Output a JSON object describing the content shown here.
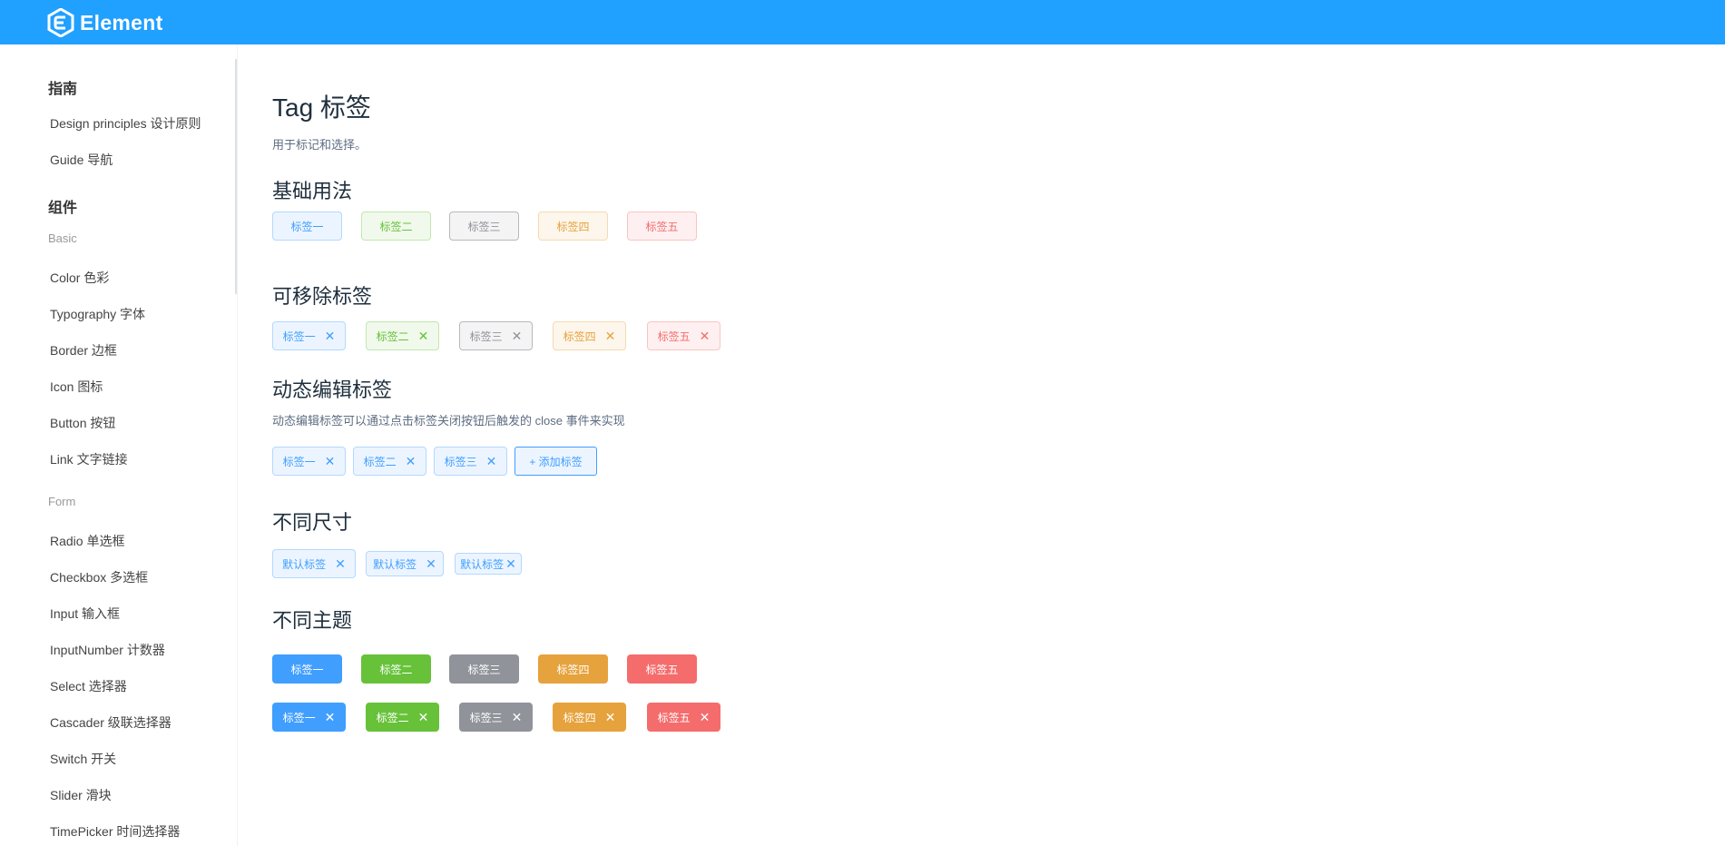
{
  "header": {
    "logo_text": "Element",
    "logo_icon": "element-logo-icon",
    "bg_color": "#20a0ff"
  },
  "sidebar": {
    "group_guide": "指南",
    "guide_items": [
      "Design principles 设计原则",
      "Guide 导航"
    ],
    "group_components": "组件",
    "sub_basic": "Basic",
    "basic_items": [
      "Color 色彩",
      "Typography 字体",
      "Border 边框",
      "Icon 图标",
      "Button 按钮",
      "Link 文字链接"
    ],
    "sub_form": "Form",
    "form_items": [
      "Radio 单选框",
      "Checkbox 多选框",
      "Input 输入框",
      "InputNumber 计数器",
      "Select 选择器",
      "Cascader 级联选择器",
      "Switch 开关",
      "Slider 滑块",
      "TimePicker 时间选择器"
    ]
  },
  "page": {
    "title": "Tag 标签",
    "desc": "用于标记和选择。"
  },
  "sections": {
    "basic": {
      "title": "基础用法",
      "tags": [
        "标签一",
        "标签二",
        "标签三",
        "标签四",
        "标签五"
      ]
    },
    "removable": {
      "title": "可移除标签",
      "tags": [
        "标签一",
        "标签二",
        "标签三",
        "标签四",
        "标签五"
      ]
    },
    "dynamic": {
      "title": "动态编辑标签",
      "desc": "动态编辑标签可以通过点击标签关闭按钮后触发的 close 事件来实现",
      "tags": [
        "标签一",
        "标签二",
        "标签三"
      ],
      "add_label": "+ 添加标签"
    },
    "sizes": {
      "title": "不同尺寸",
      "tags": [
        "默认标签",
        "默认标签",
        "默认标签"
      ]
    },
    "themes": {
      "title": "不同主题",
      "row1": [
        "标签一",
        "标签二",
        "标签三",
        "标签四",
        "标签五"
      ],
      "row2": [
        "标签一",
        "标签二",
        "标签三",
        "标签四",
        "标签五"
      ]
    }
  },
  "close_glyph": "✕",
  "colors": {
    "primary": "#409eff",
    "success": "#67c23a",
    "info": "#909399",
    "warning": "#e6a23c",
    "danger": "#f56c6c"
  }
}
